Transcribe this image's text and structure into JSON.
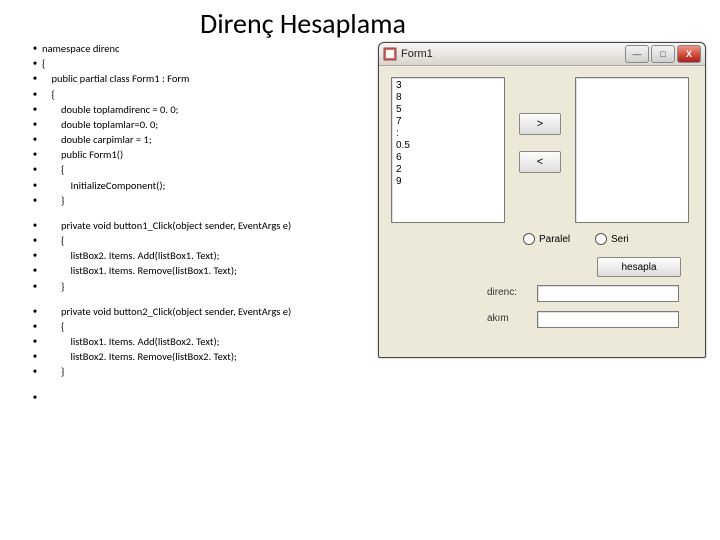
{
  "title": "Direnç Hesaplama",
  "code": {
    "block1": [
      "namespace direnc",
      "{",
      "    public partial class Form1 : Form",
      "    {",
      "        double toplamdirenc = 0. 0;",
      "        double toplamlar=0. 0;",
      "        double carpimlar = 1;",
      "        public Form1()",
      "        {",
      "            InitializeComponent();",
      "        }"
    ],
    "block2": [
      "        private void button1_Click(object sender, EventArgs e)",
      "        {",
      "            listBox2. Items. Add(listBox1. Text);",
      "            listBox1. Items. Remove(listBox1. Text);",
      "        }"
    ],
    "block3": [
      "        private void button2_Click(object sender, EventArgs e)",
      "        {",
      "            listBox1. Items. Add(listBox2. Text);",
      "            listBox2. Items. Remove(listBox2. Text);",
      "        }"
    ]
  },
  "form": {
    "title": "Form1",
    "min": "—",
    "max": "□",
    "close": "X",
    "listbox1_items": [
      "3",
      "8",
      "5",
      "7",
      ":",
      "0.5",
      "6",
      "2",
      "9"
    ],
    "btn_add": ">",
    "btn_remove": "<",
    "radio_paralel": "Paralel",
    "radio_seri": "Seri",
    "btn_calc": "hesapla",
    "label_direnc": "direnc:",
    "label_akim": "akım"
  }
}
